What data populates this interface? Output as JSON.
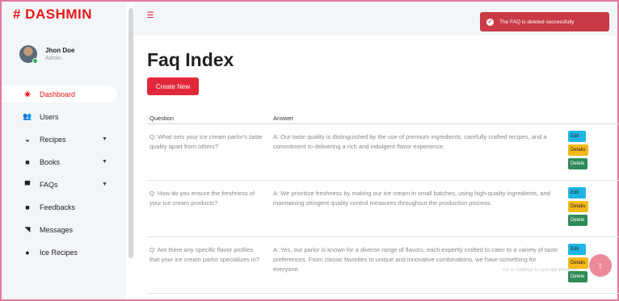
{
  "sidebar": {
    "logo": "# DASHMIN",
    "profile": {
      "name": "Jhon Doe",
      "role": "Admin"
    },
    "items": [
      {
        "label": "Dashboard",
        "icon": "gauge-icon",
        "glyph": "◉",
        "active": true,
        "caret": false
      },
      {
        "label": "Users",
        "icon": "users-icon",
        "glyph": "👥",
        "active": false,
        "caret": false
      },
      {
        "label": "Recipes",
        "icon": "bowl-icon",
        "glyph": "◒",
        "active": false,
        "caret": true
      },
      {
        "label": "Books",
        "icon": "book-icon",
        "glyph": "■",
        "active": false,
        "caret": true
      },
      {
        "label": "FAQs",
        "icon": "chat-icon",
        "glyph": "▀",
        "active": false,
        "caret": true
      },
      {
        "label": "Feedbacks",
        "icon": "feedback-icon",
        "glyph": "■",
        "active": false,
        "caret": false
      },
      {
        "label": "Messages",
        "icon": "message-icon",
        "glyph": "◥",
        "active": false,
        "caret": false
      },
      {
        "label": "Ice Recipes",
        "icon": "ice-icon",
        "glyph": "●",
        "active": false,
        "caret": false
      }
    ]
  },
  "topbar": {
    "menu_icon": "menu-icon",
    "toast": {
      "text": "The FAQ is deleted successfully",
      "color": "#c93a46"
    }
  },
  "main": {
    "title": "Faq Index",
    "create_label": "Create New",
    "table": {
      "headers": {
        "question": "Question",
        "answer": "Answer"
      },
      "rows": [
        {
          "question": "Q: What sets your ice cream parlor's taste quality apart from others?",
          "answer": "A: Our taste quality is distinguished by the use of premium ingredients, carefully crafted recipes, and a commitment to delivering a rich and indulgent flavor experience."
        },
        {
          "question": "Q: How do you ensure the freshness of your ice cream products?",
          "answer": "A: We prioritize freshness by making our ice cream in small batches, using high-quality ingredients, and maintaining stringent quality control measures throughout the production process."
        },
        {
          "question": "Q: Are there any specific flavor profiles that your ice cream parlor specializes in?",
          "answer": "A: Yes, our parlor is known for a diverse range of flavors, each expertly crafted to cater to a variety of taste preferences. From classic favorites to unique and innovative combinations, we have something for everyone."
        }
      ],
      "actions": {
        "edit": "Edit",
        "details": "Details",
        "delete": "Delete"
      }
    }
  },
  "scroll_top": {
    "glyph": "↑"
  },
  "watermark": "Go to Settings to activate Windows.",
  "colors": {
    "accent": "#eb1616",
    "edit": "#1fb6e6",
    "details": "#f5b81b",
    "delete": "#2e8b57"
  }
}
